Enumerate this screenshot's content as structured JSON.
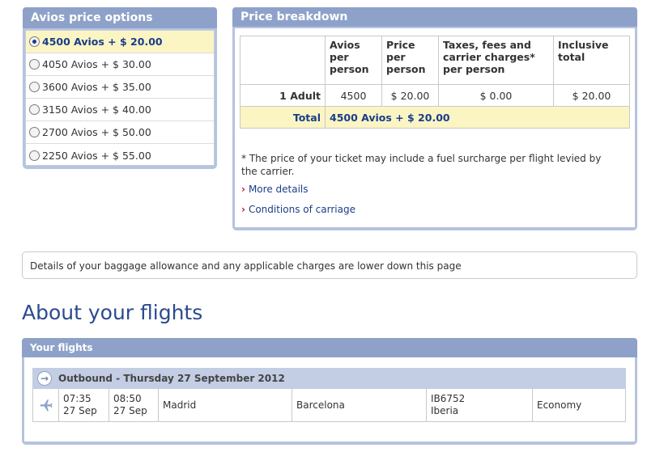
{
  "avios": {
    "title": "Avios price options",
    "options": [
      {
        "label": "4500 Avios + $ 20.00",
        "selected": true
      },
      {
        "label": "4050 Avios + $ 30.00",
        "selected": false
      },
      {
        "label": "3600 Avios + $ 35.00",
        "selected": false
      },
      {
        "label": "3150 Avios + $ 40.00",
        "selected": false
      },
      {
        "label": "2700 Avios + $ 50.00",
        "selected": false
      },
      {
        "label": "2250 Avios + $ 55.00",
        "selected": false
      }
    ]
  },
  "price": {
    "title": "Price breakdown",
    "headers": [
      "",
      "Avios per person",
      "Price per person",
      "Taxes, fees and carrier charges* per person",
      "Inclusive total"
    ],
    "adult_row": [
      "1 Adult",
      "4500",
      "$ 20.00",
      "$ 0.00",
      "$ 20.00"
    ],
    "total_label": "Total",
    "total_value": "4500 Avios + $ 20.00",
    "footnote": "* The price of your ticket may include a fuel surcharge per flight levied by the carrier.",
    "more_details": "More details",
    "conditions": "Conditions of carriage"
  },
  "baggage_note": "Details of your baggage allowance and any applicable charges are lower down this page",
  "about_title": "About your flights",
  "flights": {
    "title": "Your flights",
    "outbound": "Outbound - Thursday 27 September 2012",
    "depart_time": "07:35",
    "depart_date": "27 Sep",
    "arrive_time": "08:50",
    "arrive_date": "27 Sep",
    "from": "Madrid",
    "to": "Barcelona",
    "flight_no": "IB6752",
    "carrier": "Iberia",
    "cabin": "Economy"
  },
  "colors": {
    "accent": "#8ea2c9",
    "link": "#1a3d8a",
    "highlight": "#fbf5c4",
    "chevron": "#c8102e"
  }
}
